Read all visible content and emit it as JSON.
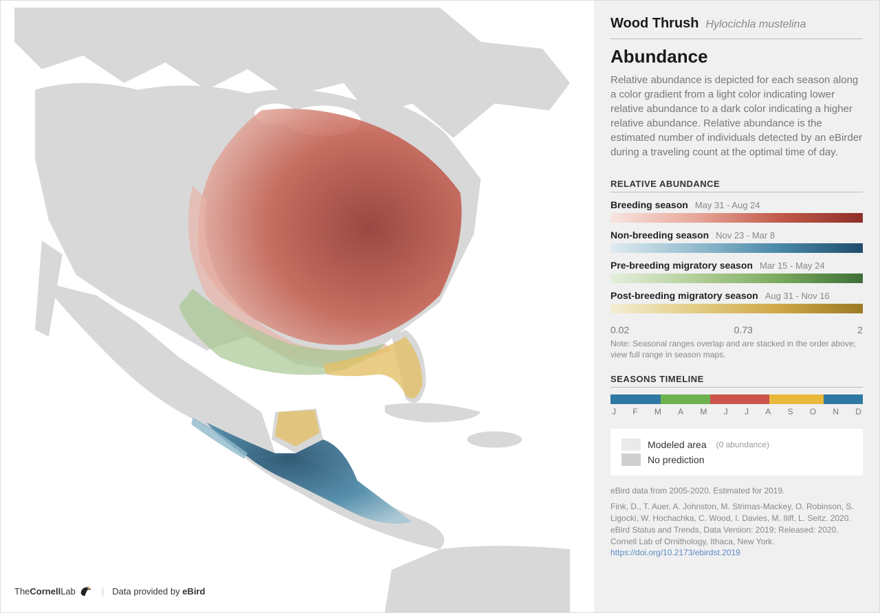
{
  "species": {
    "common_name": "Wood Thrush",
    "scientific_name": "Hylocichla mustelina"
  },
  "title": "Abundance",
  "description": "Relative abundance is depicted for each season along a color gradient from a light color indicating lower relative abundance to a dark color indicating a higher relative abundance. Relative abundance is the estimated number of individuals detected by an eBirder during a traveling count at the optimal time of day.",
  "relative_abundance": {
    "section_title": "RELATIVE ABUNDANCE",
    "seasons": [
      {
        "label": "Breeding season",
        "dates": "May 31 - Aug 24",
        "gradient_class": "grad-breeding",
        "color_low": "#f7e5e0",
        "color_high": "#8f2f28"
      },
      {
        "label": "Non-breeding season",
        "dates": "Nov 23 - Mar 8",
        "gradient_class": "grad-nonbreeding",
        "color_low": "#e0ecf0",
        "color_high": "#1f4d6b"
      },
      {
        "label": "Pre-breeding migratory season",
        "dates": "Mar 15 - May 24",
        "gradient_class": "grad-prebreeding",
        "color_low": "#e5efdc",
        "color_high": "#3f6f37"
      },
      {
        "label": "Post-breeding migratory season",
        "dates": "Aug 31 - Nov 16",
        "gradient_class": "grad-postbreeding",
        "color_low": "#f3edd4",
        "color_high": "#9a7a24"
      }
    ],
    "scale": {
      "low": "0.02",
      "mid": "0.73",
      "high": "2"
    },
    "note": "Note: Seasonal ranges overlap and are stacked in the order above; view full range in season maps."
  },
  "timeline": {
    "section_title": "SEASONS TIMELINE",
    "months": [
      "J",
      "F",
      "M",
      "A",
      "M",
      "J",
      "J",
      "A",
      "S",
      "O",
      "N",
      "D"
    ],
    "segments": [
      {
        "color_class": "tl-blue",
        "width_pct": 20
      },
      {
        "color_class": "tl-green",
        "width_pct": 19.5
      },
      {
        "color_class": "tl-red",
        "width_pct": 23.5
      },
      {
        "color_class": "tl-yellow",
        "width_pct": 21.5
      },
      {
        "color_class": "tl-blue",
        "width_pct": 15.5
      }
    ]
  },
  "legend": {
    "modeled": {
      "label": "Modeled area",
      "sub": "(0 abundance)"
    },
    "nopred": {
      "label": "No prediction"
    }
  },
  "citation": {
    "line1": "eBird data from 2005-2020. Estimated for 2019.",
    "line2": "Fink, D., T. Auer, A. Johnston, M. Strimas-Mackey, O. Robinson, S. Ligocki, W. Hochachka, C. Wood, I. Davies, M. Iliff, L. Seitz. 2020. eBird Status and Trends, Data Version: 2019; Released: 2020. Cornell Lab of Ornithology, Ithaca, New York. ",
    "link_text": "https://doi.org/10.2173/ebirdst.2019"
  },
  "footer": {
    "lab_prefix": "The",
    "lab_name": "Cornell",
    "lab_suffix": "Lab",
    "data_by": "Data provided by ",
    "ebird": "eBird"
  },
  "chart_data": {
    "type": "map",
    "region": "North and Central America",
    "overlay": "Seasonal relative abundance choropleth for Wood Thrush",
    "value_scale": {
      "min": 0.02,
      "mid": 0.73,
      "max": 2
    },
    "seasons": [
      {
        "name": "Breeding season",
        "start": "May 31",
        "end": "Aug 24",
        "color": "red"
      },
      {
        "name": "Non-breeding season",
        "start": "Nov 23",
        "end": "Mar 8",
        "color": "blue"
      },
      {
        "name": "Pre-breeding migratory season",
        "start": "Mar 15",
        "end": "May 24",
        "color": "green"
      },
      {
        "name": "Post-breeding migratory season",
        "start": "Aug 31",
        "end": "Nov 16",
        "color": "yellow"
      }
    ]
  }
}
